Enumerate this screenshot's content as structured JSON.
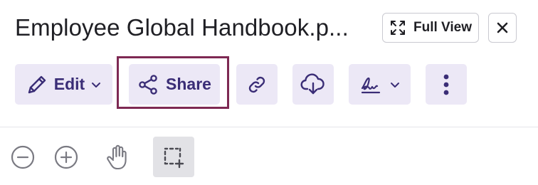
{
  "header": {
    "title": "Employee Global Handbook.p...",
    "full_view_label": "Full View"
  },
  "toolbar": {
    "edit_label": "Edit",
    "share_label": "Share"
  },
  "icons": {
    "full_view": "expand-icon",
    "close": "close-icon",
    "edit": "pencil-icon",
    "share": "share-icon",
    "link": "link-icon",
    "download": "cloud-download-icon",
    "sign": "signature-icon",
    "more": "more-vertical-icon",
    "zoom_out": "zoom-out-icon",
    "zoom_in": "zoom-in-icon",
    "pan": "hand-icon",
    "select": "area-select-icon"
  },
  "colors": {
    "accent": "#3a2d76",
    "button_bg": "#ece8f6",
    "highlight_border": "#7e2953",
    "active_tool_bg": "#e2e2e6"
  }
}
